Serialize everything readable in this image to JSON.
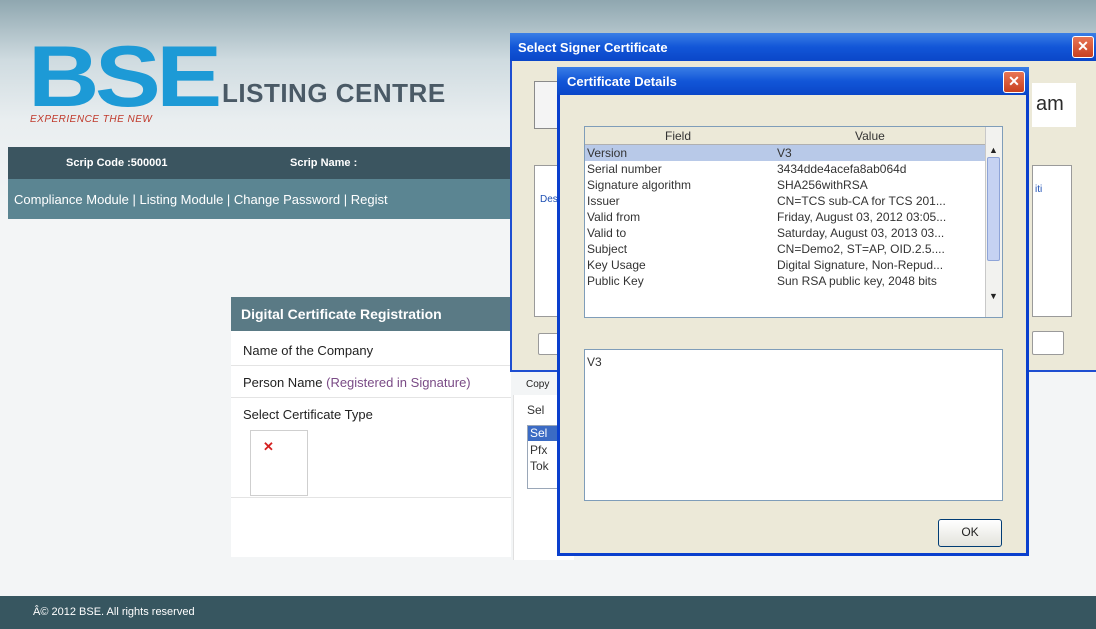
{
  "brand": {
    "logo_text": "BSE",
    "tagline": "EXPERIENCE THE NEW",
    "title": "LISTING CENTRE"
  },
  "info_bar": {
    "scrip_code": "Scrip Code :500001",
    "scrip_name": "Scrip Name :"
  },
  "nav": {
    "text": "Compliance Module  |  Listing Module  |  Change Password  |  Regist"
  },
  "registration": {
    "header": "Digital Certificate Registration",
    "company_label": "Name of the Company",
    "person_label": "Person Name",
    "person_hint": "(Registered in Signature)",
    "cert_type_label": "Select Certificate Type",
    "broken_image_glyph": "✕"
  },
  "certificate_type_list": {
    "header": "Sel",
    "options": [
      "Sel",
      "Pfx",
      "Tok"
    ]
  },
  "signer_window": {
    "title": "Select Signer Certificate",
    "close_glyph": "✕",
    "table_header_left": "Des",
    "table_header_right": "iti",
    "brand_fragment": "am",
    "copy_label": "Copy"
  },
  "details_dialog": {
    "title": "Certificate Details",
    "close_glyph": "✕",
    "columns": [
      "Field",
      "Value"
    ],
    "rows": [
      {
        "field": "Version",
        "value": "V3",
        "selected": true
      },
      {
        "field": "Serial number",
        "value": "3434dde4acefa8ab064d",
        "selected": false
      },
      {
        "field": "Signature algorithm",
        "value": "SHA256withRSA",
        "selected": false
      },
      {
        "field": "Issuer",
        "value": "CN=TCS sub-CA for TCS 201...",
        "selected": false
      },
      {
        "field": "Valid from",
        "value": "Friday, August 03, 2012 03:05...",
        "selected": false
      },
      {
        "field": "Valid to",
        "value": "Saturday, August 03, 2013 03...",
        "selected": false
      },
      {
        "field": "Subject",
        "value": "CN=Demo2, ST=AP, OID.2.5....",
        "selected": false
      },
      {
        "field": "Key Usage",
        "value": "Digital Signature, Non-Repud...",
        "selected": false
      },
      {
        "field": "Public Key",
        "value": "Sun RSA public key, 2048 bits",
        "selected": false
      }
    ],
    "value_text": "V3",
    "ok_label": "OK"
  },
  "footer": {
    "text": "Â© 2012 BSE. All rights reserved"
  }
}
